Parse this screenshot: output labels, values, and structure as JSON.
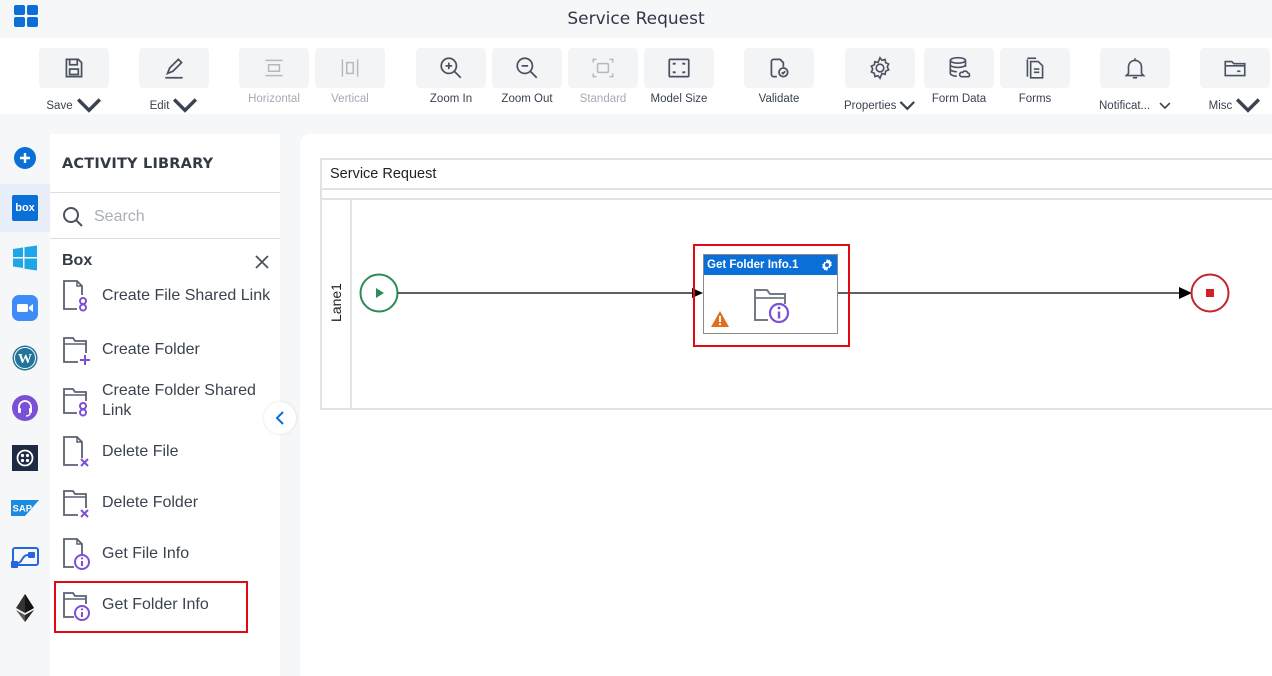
{
  "app": {
    "title": "Service Request",
    "apps_icon": "apps-grid-icon"
  },
  "toolbar": {
    "items": [
      {
        "label": "Save",
        "icon": "save-icon",
        "dropdown": true,
        "disabled": false
      },
      {
        "label": "Edit",
        "icon": "pencil-icon",
        "dropdown": true,
        "disabled": false
      },
      {
        "label": "Horizontal",
        "icon": "horizontal-layout-icon",
        "dropdown": false,
        "disabled": true
      },
      {
        "label": "Vertical",
        "icon": "vertical-layout-icon",
        "dropdown": false,
        "disabled": true
      },
      {
        "label": "Zoom In",
        "icon": "zoom-in-icon",
        "dropdown": false,
        "disabled": false
      },
      {
        "label": "Zoom Out",
        "icon": "zoom-out-icon",
        "dropdown": false,
        "disabled": false
      },
      {
        "label": "Standard",
        "icon": "standard-size-icon",
        "dropdown": false,
        "disabled": true
      },
      {
        "label": "Model Size",
        "icon": "model-size-icon",
        "dropdown": false,
        "disabled": false
      },
      {
        "label": "Validate",
        "icon": "validate-icon",
        "dropdown": false,
        "disabled": false
      },
      {
        "label": "Properties",
        "icon": "gear-icon",
        "dropdown": true,
        "disabled": false
      },
      {
        "label": "Form Data",
        "icon": "database-icon",
        "dropdown": false,
        "disabled": false
      },
      {
        "label": "Forms",
        "icon": "forms-icon",
        "dropdown": false,
        "disabled": false
      },
      {
        "label": "Notificat...",
        "icon": "bell-icon",
        "dropdown": true,
        "disabled": false
      },
      {
        "label": "Misc",
        "icon": "folder-icon",
        "dropdown": true,
        "disabled": false
      }
    ]
  },
  "left_rail": {
    "items": [
      {
        "name": "add",
        "icon": "plus-circle-icon",
        "active": false
      },
      {
        "name": "box",
        "icon": "box-logo-icon",
        "active": true,
        "text": "box"
      },
      {
        "name": "windows",
        "icon": "windows-logo-icon",
        "active": false
      },
      {
        "name": "zoom",
        "icon": "zoom-logo-icon",
        "active": false
      },
      {
        "name": "wordpress",
        "icon": "wordpress-logo-icon",
        "active": false
      },
      {
        "name": "support",
        "icon": "headset-icon",
        "active": false
      },
      {
        "name": "twilio",
        "icon": "twilio-logo-icon",
        "active": false
      },
      {
        "name": "sap",
        "icon": "sap-logo-icon",
        "active": false,
        "text": "SAP"
      },
      {
        "name": "power-automate",
        "icon": "power-automate-icon",
        "active": false
      },
      {
        "name": "ethereum",
        "icon": "ethereum-logo-icon",
        "active": false
      }
    ]
  },
  "activity_library": {
    "title": "ACTIVITY LIBRARY",
    "search_placeholder": "Search",
    "category": "Box",
    "items": [
      {
        "label": "Create File Shared Link",
        "icon": "file-link-icon"
      },
      {
        "label": "Create Folder",
        "icon": "folder-plus-icon"
      },
      {
        "label": "Create Folder Shared Link",
        "icon": "folder-link-icon"
      },
      {
        "label": "Delete File",
        "icon": "file-delete-icon"
      },
      {
        "label": "Delete Folder",
        "icon": "folder-delete-icon"
      },
      {
        "label": "Get File Info",
        "icon": "file-info-icon"
      },
      {
        "label": "Get Folder Info",
        "icon": "folder-info-icon",
        "highlighted": true
      }
    ]
  },
  "canvas": {
    "pool_name": "Service Request",
    "lane_name": "Lane1",
    "task": {
      "title": "Get Folder Info.1",
      "icon": "folder-info-icon",
      "warning": true,
      "selected": true
    },
    "start_event": "start-event",
    "end_event": "end-event"
  },
  "colors": {
    "accent": "#0a6fd6",
    "highlight": "#e10a12",
    "start": "#2e8b57",
    "end": "#c0272d",
    "icon_purple": "#7b4fd6",
    "warning": "#e07020"
  }
}
